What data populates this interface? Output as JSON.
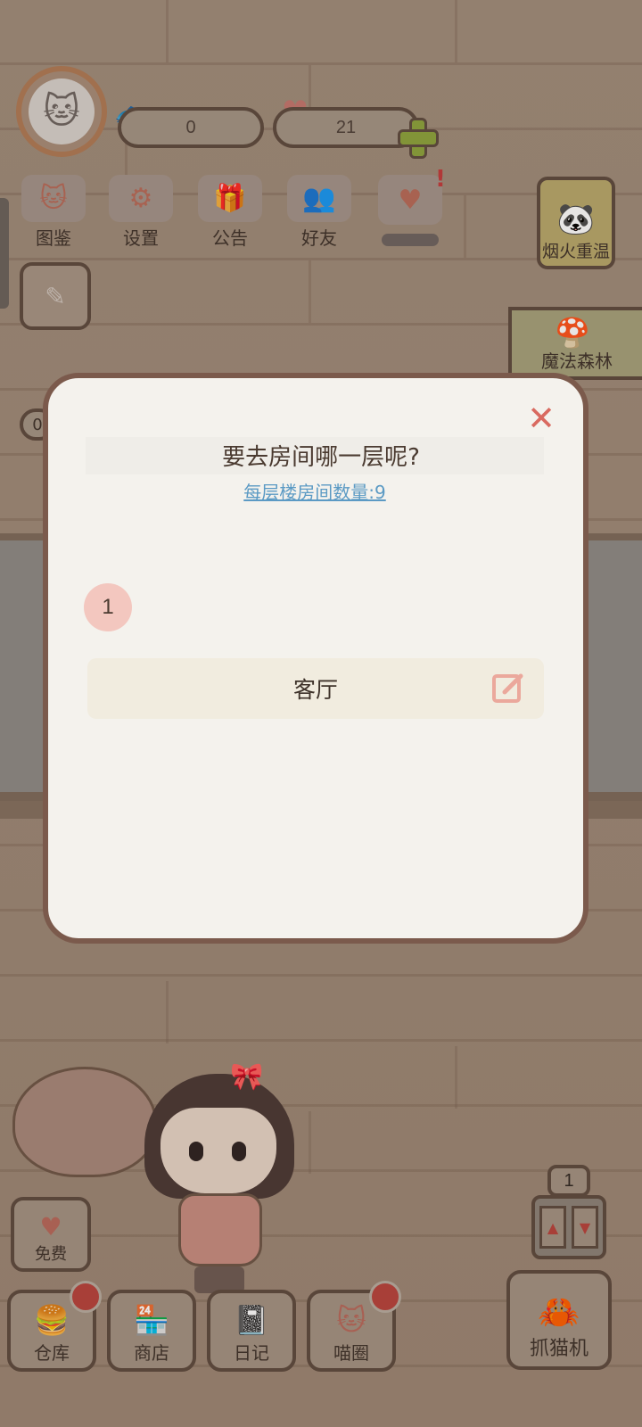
{
  "hud": {
    "fish_count": "0",
    "heart_count": "21"
  },
  "menu": {
    "items": [
      {
        "label": "图鉴",
        "icon": "cat-book-icon"
      },
      {
        "label": "设置",
        "icon": "gear-icon"
      },
      {
        "label": "公告",
        "icon": "gift-icon"
      },
      {
        "label": "好友",
        "icon": "friends-icon"
      },
      {
        "label": "",
        "icon": "hearts-icon"
      }
    ]
  },
  "event": {
    "fireworks_label": "烟火重温",
    "forest_label": "魔法森林"
  },
  "left_counter": "0",
  "modal": {
    "title": "要去房间哪一层呢?",
    "subtitle": "每层楼房间数量:9",
    "floor_number": "1",
    "room_name": "客厅"
  },
  "bottom": {
    "free_label": "免费",
    "buttons": [
      {
        "label": "仓库",
        "icon": "warehouse-icon"
      },
      {
        "label": "商店",
        "icon": "shop-icon"
      },
      {
        "label": "日记",
        "icon": "diary-icon"
      },
      {
        "label": "喵圈",
        "icon": "cat-planet-icon"
      }
    ],
    "elevator_floor": "1",
    "claw_label": "抓猫机"
  },
  "colors": {
    "modal_border": "#7b5a4c",
    "close_red": "#d96a60",
    "link_blue": "#5b9ac4",
    "floor_badge": "#f3c7bf",
    "room_row_bg": "#f1ecdf"
  }
}
